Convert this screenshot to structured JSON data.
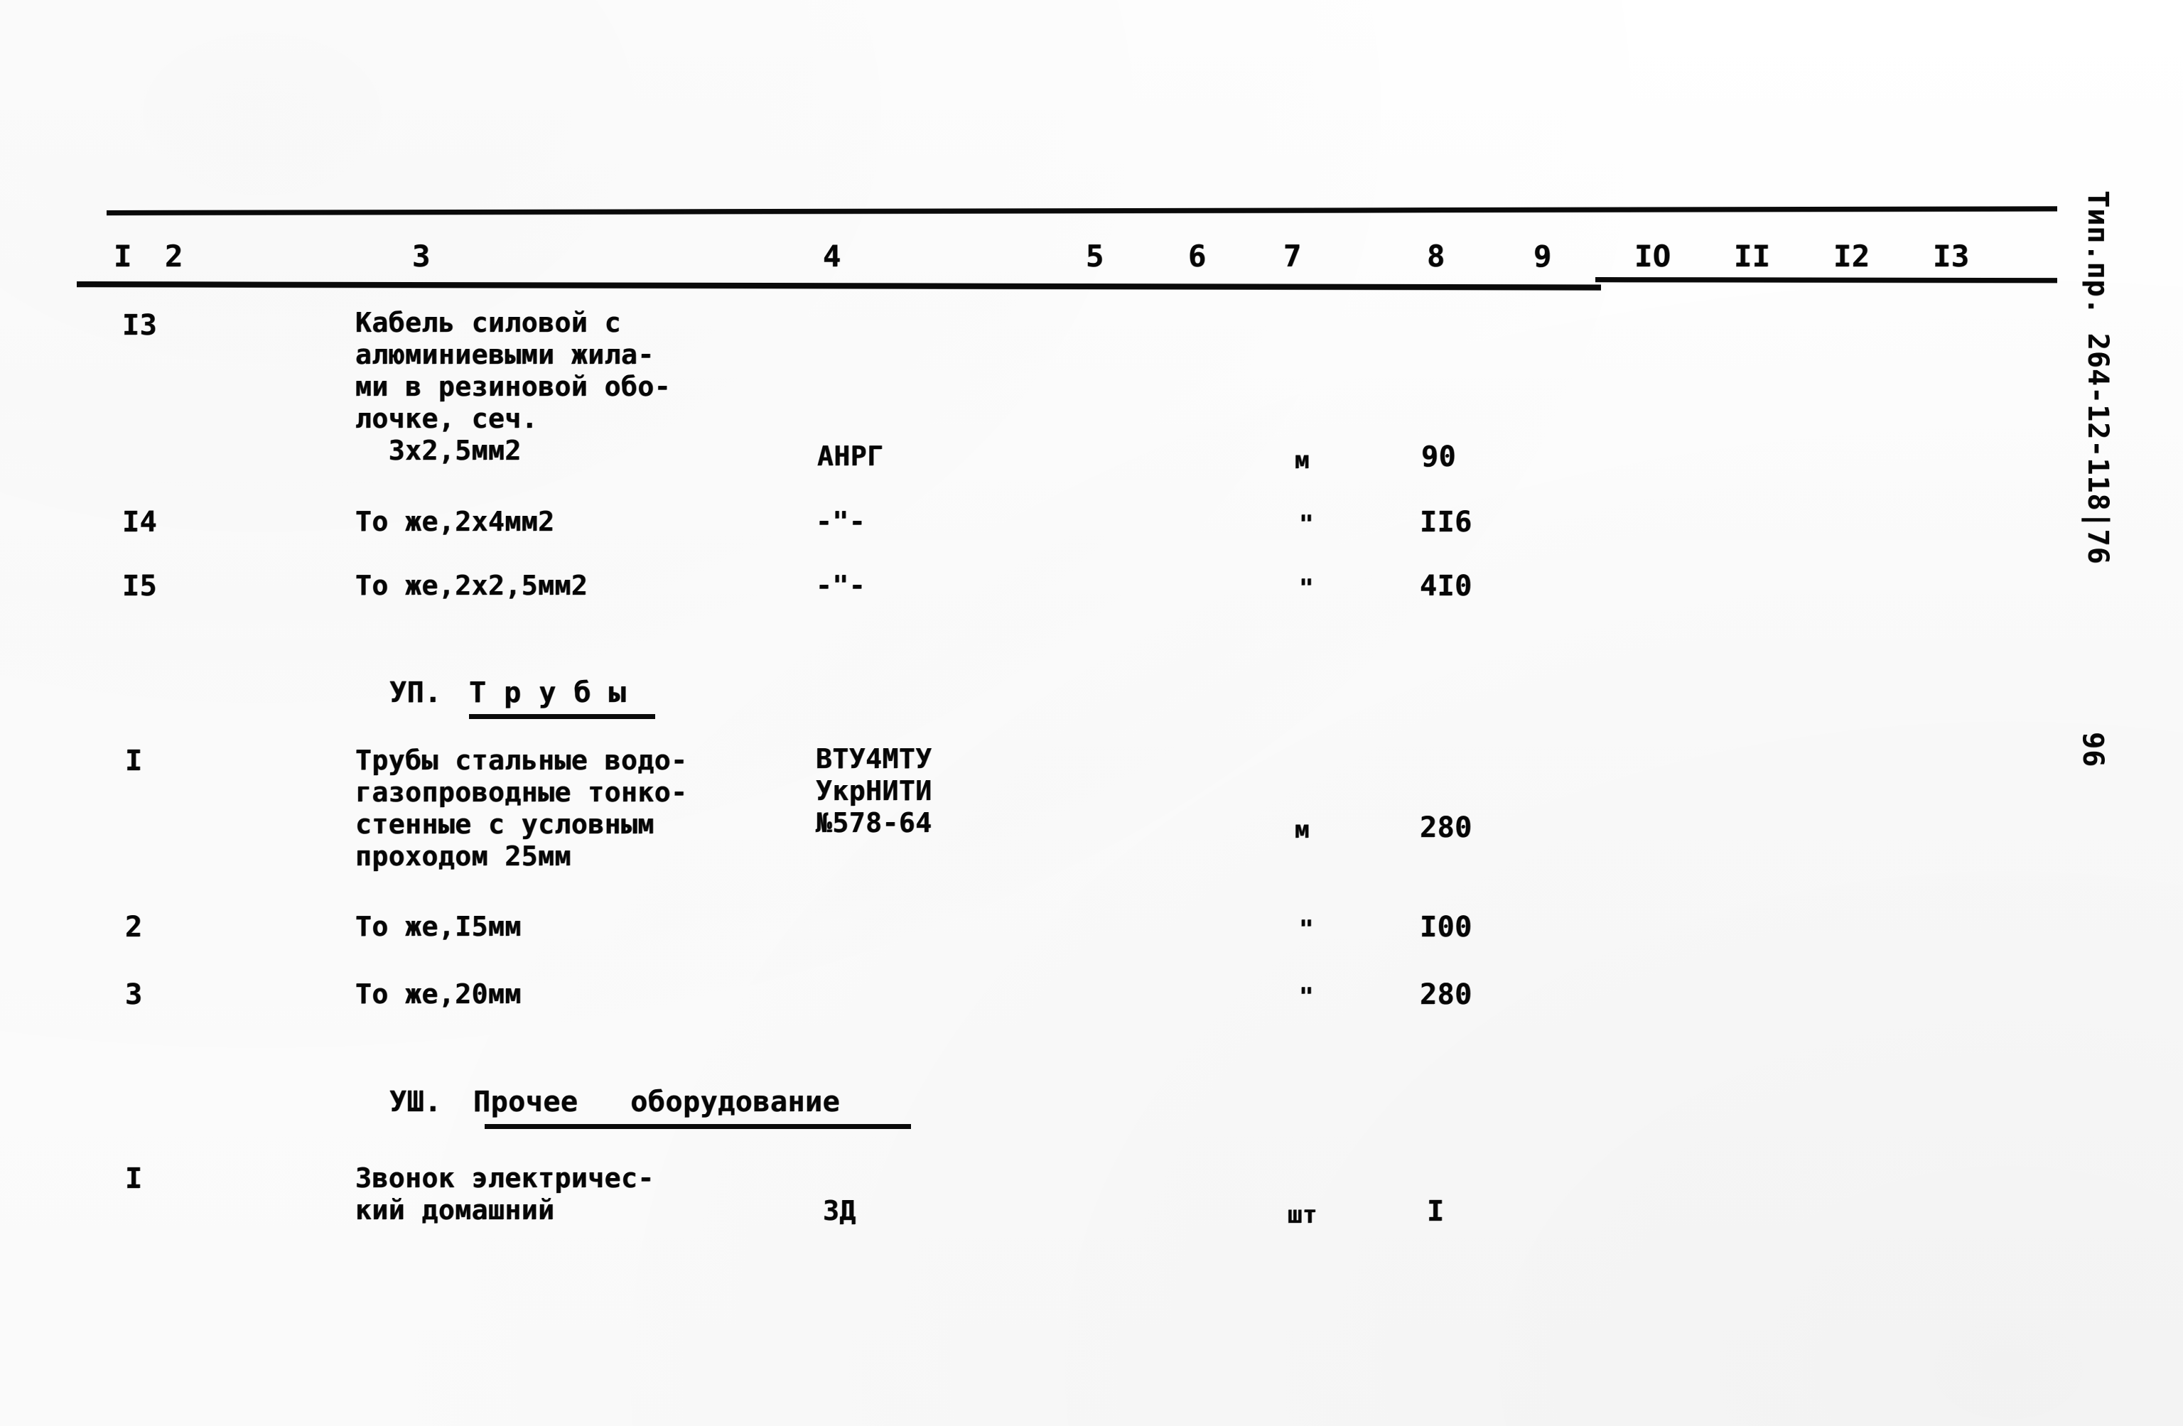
{
  "document": {
    "kind": "scanned-specification-table",
    "margin_code": "Тип.пр. 264-12-118|76",
    "page_number": "96"
  },
  "table": {
    "column_headers": [
      "I",
      "2",
      "3",
      "4",
      "5",
      "6",
      "7",
      "8",
      "9",
      "IO",
      "II",
      "I2",
      "I3"
    ],
    "rows": [
      {
        "num": "I3",
        "name": "Кабель силовой с\nалюминиевыми жила-\nми в резиновой обо-\nлочке, сеч.\n  3х2,5мм2",
        "spec": "АНРГ",
        "unit": "м",
        "qty": "90"
      },
      {
        "num": "I4",
        "name": "То же,2х4мм2",
        "spec": "-\"-",
        "unit": "\"",
        "qty": "II6"
      },
      {
        "num": "I5",
        "name": "То же,2х2,5мм2",
        "spec": "-\"-",
        "unit": "\"",
        "qty": "4I0"
      },
      {
        "num": "I",
        "name": "Трубы стальные водо-\nгазопроводные тонко-\nстенные с условным\nпроходом 25мм",
        "spec": "ВТУ4МТУ\nУкрНИТИ\n№578-64",
        "unit": "м",
        "qty": "280"
      },
      {
        "num": "2",
        "name": "То же,I5мм",
        "spec": "",
        "unit": "\"",
        "qty": "I00"
      },
      {
        "num": "3",
        "name": "То же,20мм",
        "spec": "",
        "unit": "\"",
        "qty": "280"
      },
      {
        "num": "I",
        "name": "Звонок электричес-\nкий домашний",
        "spec": "ЗД",
        "unit": "шт",
        "qty": "I"
      }
    ],
    "sections": [
      {
        "numeral": "УП.",
        "title": "Т р у б ы"
      },
      {
        "numeral": "УШ.",
        "title": "Прочее   оборудование"
      }
    ]
  }
}
